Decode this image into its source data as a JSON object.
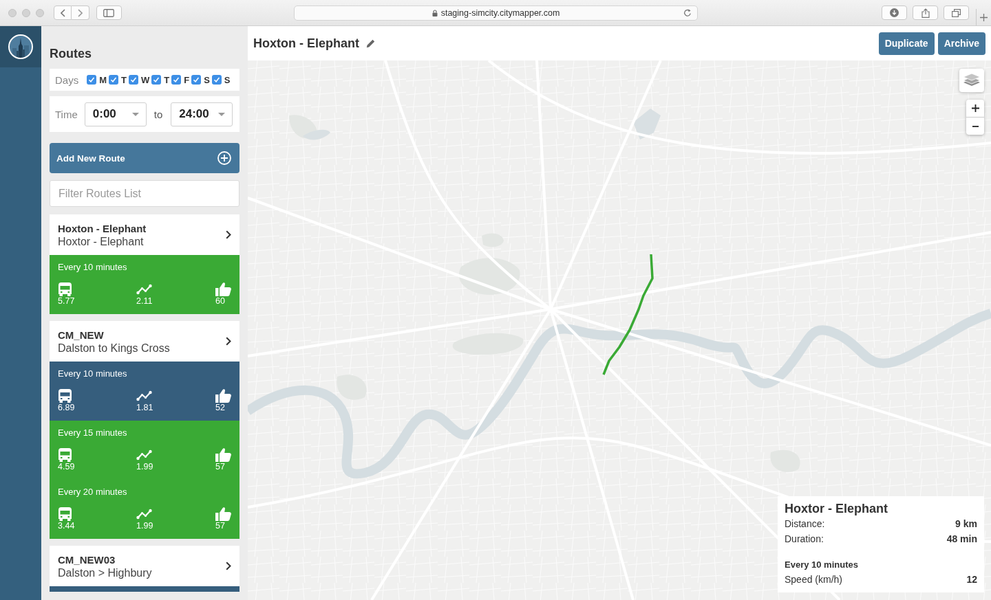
{
  "browser": {
    "url": "staging-simcity.citymapper.com"
  },
  "sidebar": {
    "title": "Routes",
    "days": {
      "label": "Days",
      "items": [
        {
          "letter": "M",
          "checked": true
        },
        {
          "letter": "T",
          "checked": true
        },
        {
          "letter": "W",
          "checked": true
        },
        {
          "letter": "T",
          "checked": true
        },
        {
          "letter": "F",
          "checked": true
        },
        {
          "letter": "S",
          "checked": true
        },
        {
          "letter": "S",
          "checked": true
        }
      ]
    },
    "time": {
      "label": "Time",
      "from": "0:00",
      "separator": "to",
      "to": "24:00"
    },
    "add_route_button": "Add New Route",
    "filter": {
      "placeholder": "Filter Routes List"
    },
    "routes": [
      {
        "name": "Hoxton - Elephant",
        "description": "Hoxtor - Elephant",
        "frequencies": [
          {
            "label": "Every 10 minutes",
            "color": "#3aaa35",
            "stats": [
              {
                "kind": "bus",
                "value": "5.77"
              },
              {
                "kind": "trend",
                "value": "2.11"
              },
              {
                "kind": "rating",
                "value": "60"
              }
            ]
          }
        ]
      },
      {
        "name": "CM_NEW",
        "description": "Dalston to Kings Cross",
        "frequencies": [
          {
            "label": "Every 10 minutes",
            "color": "#365e7d",
            "stats": [
              {
                "kind": "bus",
                "value": "6.89"
              },
              {
                "kind": "trend",
                "value": "1.81"
              },
              {
                "kind": "rating",
                "value": "52"
              }
            ]
          },
          {
            "label": "Every 15 minutes",
            "color": "#3aaa35",
            "stats": [
              {
                "kind": "bus",
                "value": "4.59"
              },
              {
                "kind": "trend",
                "value": "1.99"
              },
              {
                "kind": "rating",
                "value": "57"
              }
            ]
          },
          {
            "label": "Every 20 minutes",
            "color": "#3aaa35",
            "stats": [
              {
                "kind": "bus",
                "value": "3.44"
              },
              {
                "kind": "trend",
                "value": "1.99"
              },
              {
                "kind": "rating",
                "value": "57"
              }
            ]
          }
        ]
      },
      {
        "name": "CM_NEW03",
        "description": "Dalston > Highbury",
        "frequencies": [
          {
            "color": "#365e7d"
          }
        ]
      }
    ]
  },
  "header": {
    "title": "Hoxton - Elephant",
    "buttons": [
      "Duplicate",
      "Archive"
    ]
  },
  "info_panel": {
    "title": "Hoxtor - Elephant",
    "rows": [
      {
        "label": "Distance:",
        "value": "9 km"
      },
      {
        "label": "Duration:",
        "value": "48 min"
      }
    ],
    "frequency": "Every 10 minutes",
    "speed": {
      "label": "Speed (km/h)",
      "value": "12"
    }
  }
}
